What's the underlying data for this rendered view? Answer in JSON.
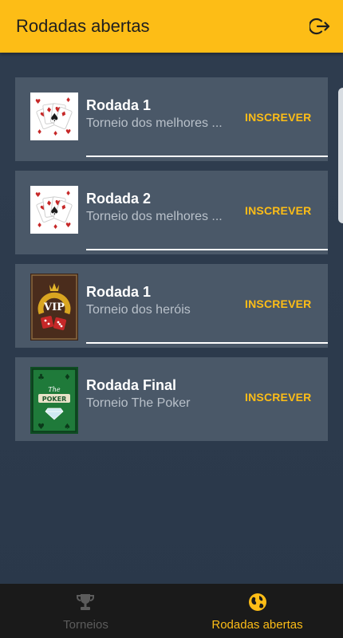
{
  "header": {
    "title": "Rodadas abertas",
    "logout_icon": "logout-icon"
  },
  "rounds": [
    {
      "title": "Rodada 1",
      "subtitle": "Torneio dos melhores ...",
      "action": "INSCREVER",
      "image": "playing-cards-image"
    },
    {
      "title": "Rodada 2",
      "subtitle": "Torneio dos melhores ...",
      "action": "INSCREVER",
      "image": "playing-cards-image"
    },
    {
      "title": "Rodada 1",
      "subtitle": "Torneio dos heróis",
      "action": "INSCREVER",
      "image": "vip-dice-image"
    },
    {
      "title": "Rodada Final",
      "subtitle": "Torneio The Poker",
      "action": "INSCREVER",
      "image": "the-poker-image"
    }
  ],
  "bottom_nav": {
    "items": [
      {
        "label": "Torneios",
        "icon": "trophy-icon",
        "active": false
      },
      {
        "label": "Rodadas abertas",
        "icon": "globe-icon",
        "active": true
      }
    ]
  },
  "colors": {
    "accent": "#fdbd16",
    "background": "#2c3a4b",
    "card": "#4a5868",
    "nav": "#1a1a1a",
    "inactive": "#5c5c5c"
  }
}
